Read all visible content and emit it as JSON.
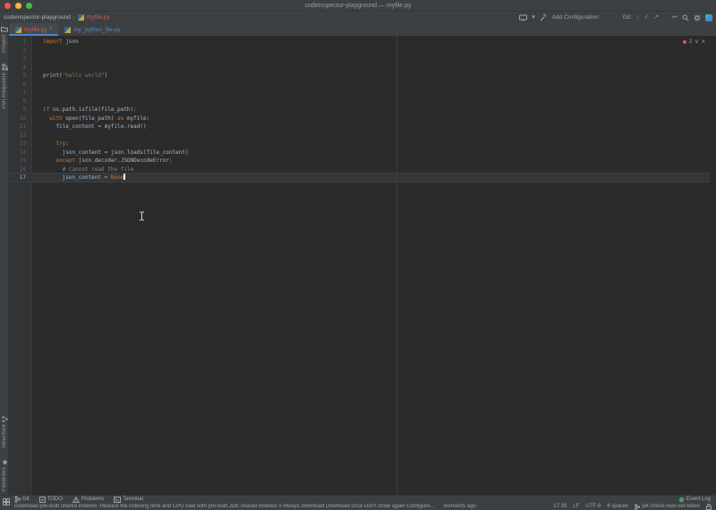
{
  "window": {
    "title": "codeinspector-playground — myfile.py"
  },
  "navbar": {
    "project": "codeinspector-playground",
    "chevron": "›",
    "file": "myfile.py"
  },
  "toolbar": {
    "dropdown_glyph": "▾",
    "add_configuration": "Add Configuration",
    "git_label": "Git:",
    "update_glyph": "↓",
    "commit_glyph": "✓",
    "push_glyph": "↗",
    "undo_glyph": "↩"
  },
  "tabs": [
    {
      "label": "myfile.py",
      "modified_mark": "*",
      "icon": "python-file-icon",
      "active": true,
      "color": "#d05b56"
    },
    {
      "label": "my_python_file.py",
      "modified_mark": "",
      "icon": "python-file-icon",
      "active": false,
      "color": "#5b87c0"
    }
  ],
  "stripes": {
    "top": [
      {
        "label": "Project",
        "icon": "folder-icon"
      },
      {
        "label": "Pull Requests",
        "icon": "pull-requests-icon"
      }
    ],
    "bottom": [
      {
        "label": "Structure",
        "icon": "structure-icon"
      },
      {
        "label": "Favorites",
        "icon": "favorites-icon"
      }
    ]
  },
  "editor": {
    "inspection": {
      "error_count": "2",
      "down_glyph": "∨",
      "up_glyph": "∧"
    },
    "lines": [
      {
        "num": "1",
        "tokens": [
          {
            "t": "import ",
            "c": "kw"
          },
          {
            "t": "json"
          }
        ]
      },
      {
        "num": "2",
        "tokens": []
      },
      {
        "num": "3",
        "tokens": []
      },
      {
        "num": "4",
        "tokens": []
      },
      {
        "num": "5",
        "tokens": [
          {
            "t": "print("
          },
          {
            "t": "\"hello world\"",
            "c": "str"
          },
          {
            "t": ")"
          }
        ]
      },
      {
        "num": "6",
        "tokens": []
      },
      {
        "num": "7",
        "tokens": []
      },
      {
        "num": "8",
        "tokens": []
      },
      {
        "num": "9",
        "tokens": [
          {
            "t": "if ",
            "c": "kw"
          },
          {
            "t": "os.path.isfile(file_path):"
          }
        ]
      },
      {
        "num": "10",
        "tokens": [
          {
            "t": "  "
          },
          {
            "t": "with ",
            "c": "kw"
          },
          {
            "t": "open(file_path) "
          },
          {
            "t": "as ",
            "c": "kw"
          },
          {
            "t": "myfile:"
          }
        ]
      },
      {
        "num": "11",
        "tokens": [
          {
            "t": "    file_content = myfile.read()"
          }
        ]
      },
      {
        "num": "12",
        "tokens": []
      },
      {
        "num": "13",
        "tokens": [
          {
            "t": "    "
          },
          {
            "t": "try",
            "c": "kw"
          },
          {
            "t": ":"
          }
        ]
      },
      {
        "num": "14",
        "tokens": [
          {
            "t": "      json_content = json.loads(file_content)"
          }
        ]
      },
      {
        "num": "15",
        "tokens": [
          {
            "t": "    "
          },
          {
            "t": "except ",
            "c": "kw"
          },
          {
            "t": "json.decoder.JSONDecodeError:"
          }
        ]
      },
      {
        "num": "16",
        "tokens": [
          {
            "t": "      "
          },
          {
            "t": "# Cannot read the file",
            "c": "cm"
          }
        ]
      },
      {
        "num": "17",
        "tokens": [
          {
            "t": "      json_content = "
          },
          {
            "t": "None",
            "c": "kw"
          }
        ],
        "current": true,
        "caret": true
      }
    ]
  },
  "tool_windows": {
    "left": [
      {
        "label": "Git",
        "icon": "git-icon"
      },
      {
        "label": "TODO",
        "icon": "todo-icon"
      },
      {
        "label": "Problems",
        "icon": "problems-icon"
      },
      {
        "label": "Terminal",
        "icon": "terminal-icon"
      }
    ],
    "right": [
      {
        "label": "Event Log",
        "icon": "event-log-icon"
      }
    ]
  },
  "status_bar": {
    "message": "Download pre-built shared indexes: Reduce the indexing time and CPU load with pre-built JDK shared indexes // Always download  Download once  Don't show again  Configure...",
    "time": "moments ago",
    "caret_position": "17:39",
    "line_ending": "LF",
    "encoding": "UTF-8",
    "indent": "4 spaces",
    "branch": "jwt-check-new-set-token"
  },
  "colors": {
    "accent_blue": "#4a88c8",
    "error_red": "#d05b56",
    "modified_blue": "#5b87c0",
    "keyword": "#cc7832",
    "string": "#6a8759",
    "comment": "#7d8288"
  }
}
